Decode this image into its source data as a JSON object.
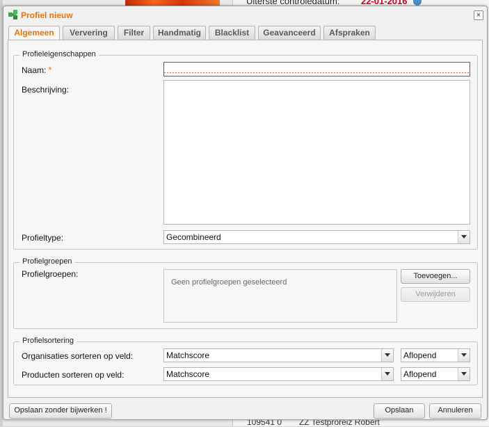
{
  "background": {
    "top_label": "Uiterste controledatum:",
    "top_date": "22-01-2016",
    "bottom_id": "109541 0",
    "bottom_name": "ZZ Testproreiz Robert"
  },
  "dialog": {
    "title": "Profiel nieuw",
    "close_label": "×",
    "tabs": [
      {
        "label": "Algemeen",
        "active": true
      },
      {
        "label": "Ververing",
        "active": false
      },
      {
        "label": "Filter",
        "active": false
      },
      {
        "label": "Handmatig",
        "active": false
      },
      {
        "label": "Blacklist",
        "active": false
      },
      {
        "label": "Geavanceerd",
        "active": false
      },
      {
        "label": "Afspraken",
        "active": false
      }
    ]
  },
  "properties": {
    "legend": "Profieleigenschappen",
    "name_label": "Naam:",
    "required_marker": "*",
    "name_value": "",
    "description_label": "Beschrijving:",
    "description_value": "",
    "type_label": "Profieltype:",
    "type_value": "Gecombineerd"
  },
  "groups": {
    "legend": "Profielgroepen",
    "label": "Profielgroepen:",
    "empty_text": "Geen profielgroepen geselecteerd",
    "add_button": "Toevoegen...",
    "remove_button": "Verwijderen"
  },
  "sorting": {
    "legend": "Profielsortering",
    "org_label": "Organisaties sorteren op veld:",
    "org_field": "Matchscore",
    "org_order": "Aflopend",
    "prod_label": "Producten sorteren op veld:",
    "prod_field": "Matchscore",
    "prod_order": "Aflopend"
  },
  "footer": {
    "save_no_update": "Opslaan zonder bijwerken !",
    "save": "Opslaan",
    "cancel": "Annuleren"
  },
  "colors": {
    "title": "#e8730c",
    "active_tab": "#e8730c",
    "required": "#e8730c",
    "error_border": "#c8321e"
  }
}
